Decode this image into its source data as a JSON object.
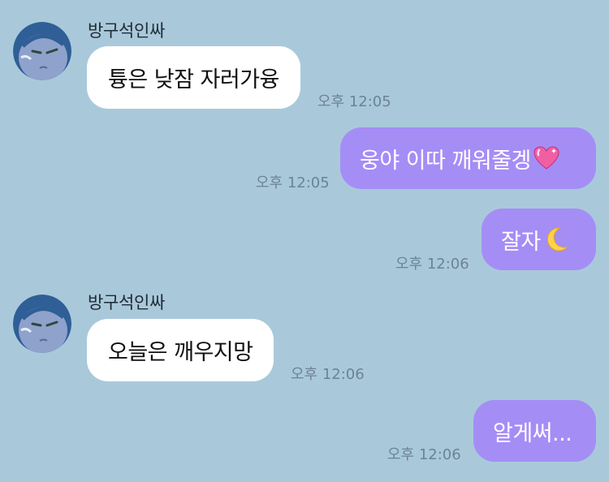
{
  "chat": {
    "messages": [
      {
        "sender": "방구석인싸",
        "text": "튱은 낮잠 자러가융",
        "time": "오후 12:05"
      },
      {
        "text": "웅야 이따 깨워줄겡",
        "time": "오후 12:05",
        "emoji": "sparkling-heart"
      },
      {
        "text": "잘자",
        "time": "오후 12:06",
        "emoji": "crescent-moon"
      },
      {
        "sender": "방구석인싸",
        "text": "오늘은 깨우지망",
        "time": "오후 12:06"
      },
      {
        "text": "알게써...",
        "time": "오후 12:06"
      }
    ]
  },
  "colors": {
    "background": "#a9c9db",
    "incoming_bubble": "#ffffff",
    "outgoing_bubble": "#a58df6",
    "timestamp": "#6d8393"
  }
}
